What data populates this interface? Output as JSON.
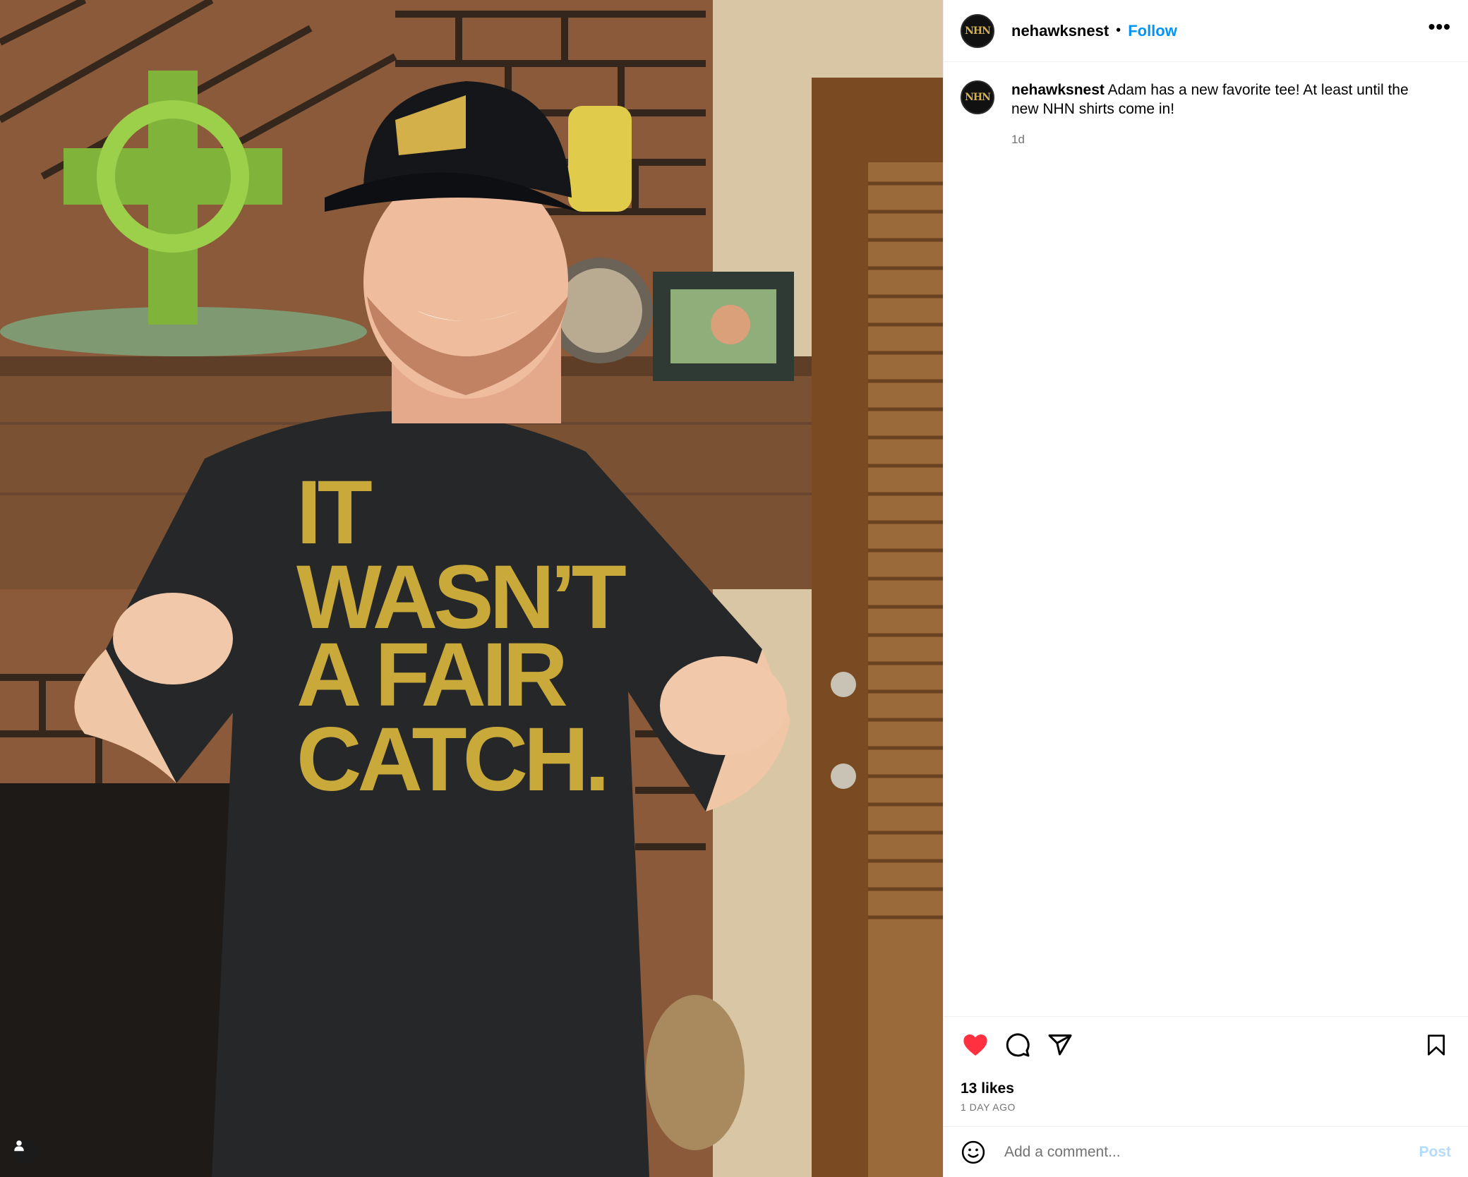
{
  "post": {
    "photo": {
      "shirt_text_lines": [
        "IT",
        "WASN’T",
        "A FAIR",
        "CATCH."
      ]
    },
    "header": {
      "username": "nehawksnest",
      "separator": "•",
      "follow_label": "Follow",
      "more_label": "•••",
      "avatar_text": "NHN"
    },
    "caption": {
      "username": "nehawksnest",
      "text": "Adam has a new favorite tee! At least until the new NHN shirts come in!",
      "time": "1d"
    },
    "stats": {
      "likes": "13 likes",
      "time_ago": "1 DAY AGO"
    },
    "comment_box": {
      "placeholder": "Add a comment...",
      "post_label": "Post"
    },
    "icons": {
      "like": "heart-filled-icon",
      "comment": "comment-icon",
      "share": "share-icon",
      "save": "bookmark-icon",
      "emoji": "emoji-icon",
      "tag": "user-tag-icon"
    },
    "colors": {
      "like": "#ff3040",
      "follow": "#0095f6",
      "post_disabled": "#b3dbff",
      "shirt_print": "#c9a93a"
    }
  }
}
